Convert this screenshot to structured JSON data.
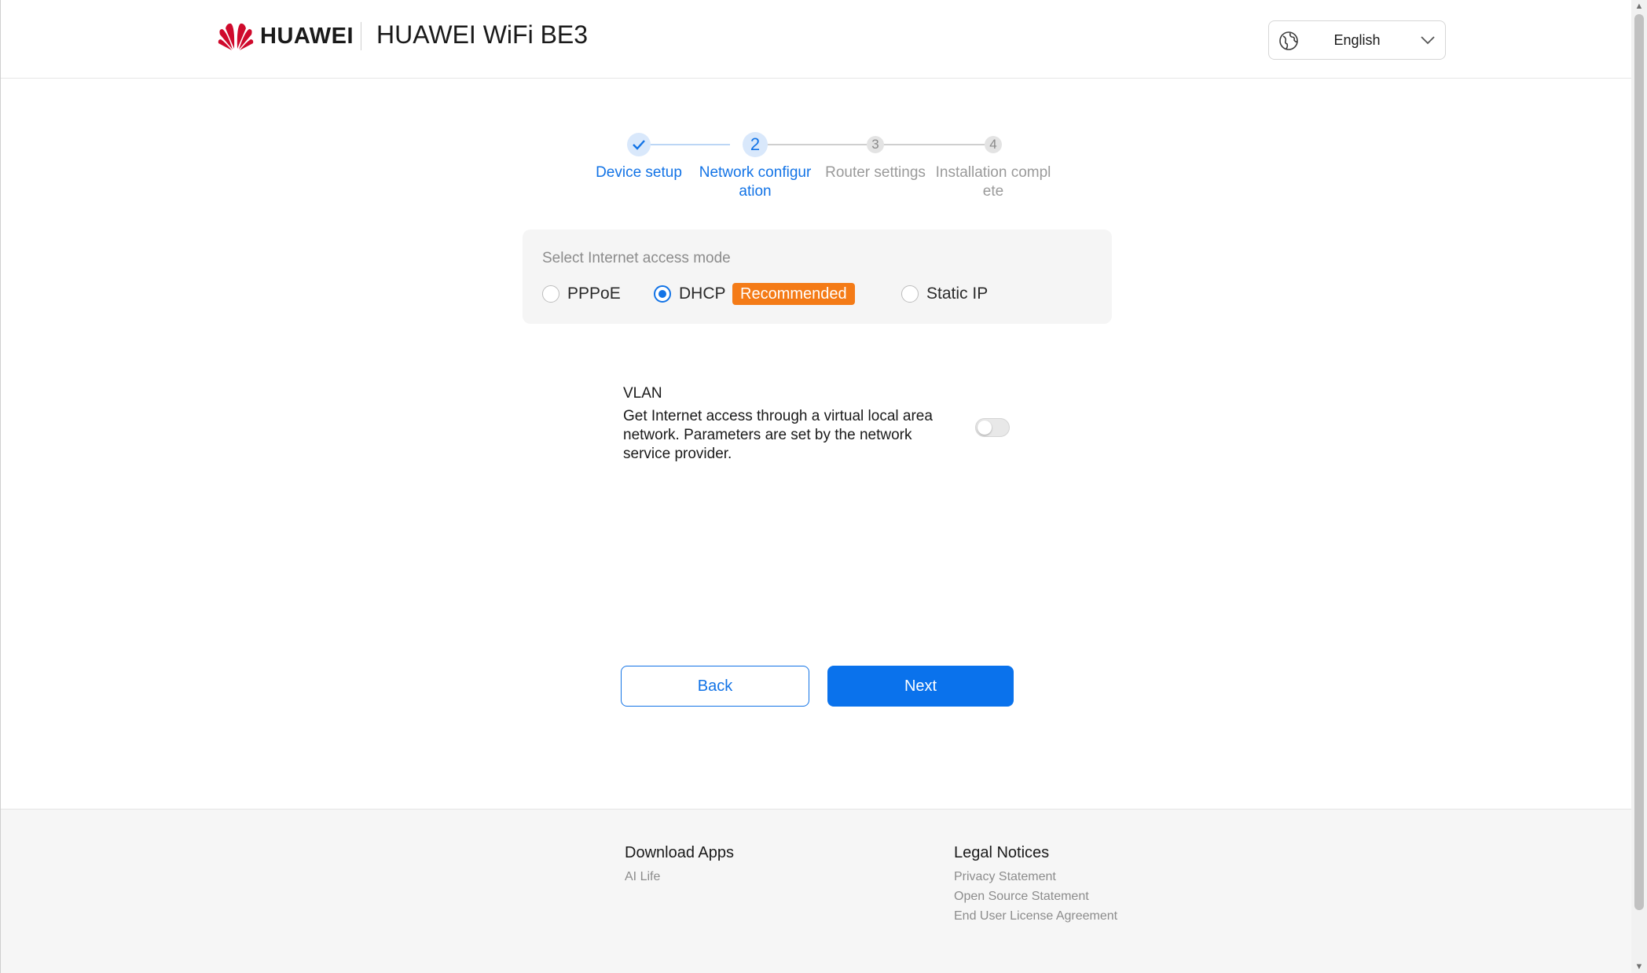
{
  "header": {
    "brand": "HUAWEI",
    "product_title": "HUAWEI WiFi BE3",
    "language": "English"
  },
  "stepper": {
    "steps": [
      {
        "number": "✓",
        "label_line1": "Device setup",
        "label_line2": "",
        "state": "done"
      },
      {
        "number": "2",
        "label_line1": "Network configur",
        "label_line2": "ation",
        "state": "active"
      },
      {
        "number": "3",
        "label_line1": "Router settings",
        "label_line2": "",
        "state": "todo"
      },
      {
        "number": "4",
        "label_line1": "Installation compl",
        "label_line2": "ete",
        "state": "todo"
      }
    ]
  },
  "access_mode": {
    "title": "Select Internet access mode",
    "options": [
      {
        "label": "PPPoE",
        "selected": false
      },
      {
        "label": "DHCP",
        "selected": true
      },
      {
        "label": "Static IP",
        "selected": false
      }
    ],
    "recommended_badge": "Recommended"
  },
  "vlan": {
    "title": "VLAN",
    "description": "Get Internet access through a virtual local area network. Parameters are set by the network service provider.",
    "enabled": false
  },
  "buttons": {
    "back": "Back",
    "next": "Next"
  },
  "footer": {
    "download": {
      "heading": "Download Apps",
      "links": [
        "AI Life"
      ]
    },
    "legal": {
      "heading": "Legal Notices",
      "links": [
        "Privacy Statement",
        "Open Source Statement",
        "End User License Agreement"
      ]
    }
  },
  "colors": {
    "accent": "#1273e6",
    "primary_button": "#0a72ec",
    "badge": "#f47b17",
    "brand_red": "#cf0a2c"
  },
  "icons": {
    "logo": "huawei-logo",
    "language": "globe-icon",
    "dropdown": "chevron-down-icon",
    "step_done": "check-icon"
  }
}
